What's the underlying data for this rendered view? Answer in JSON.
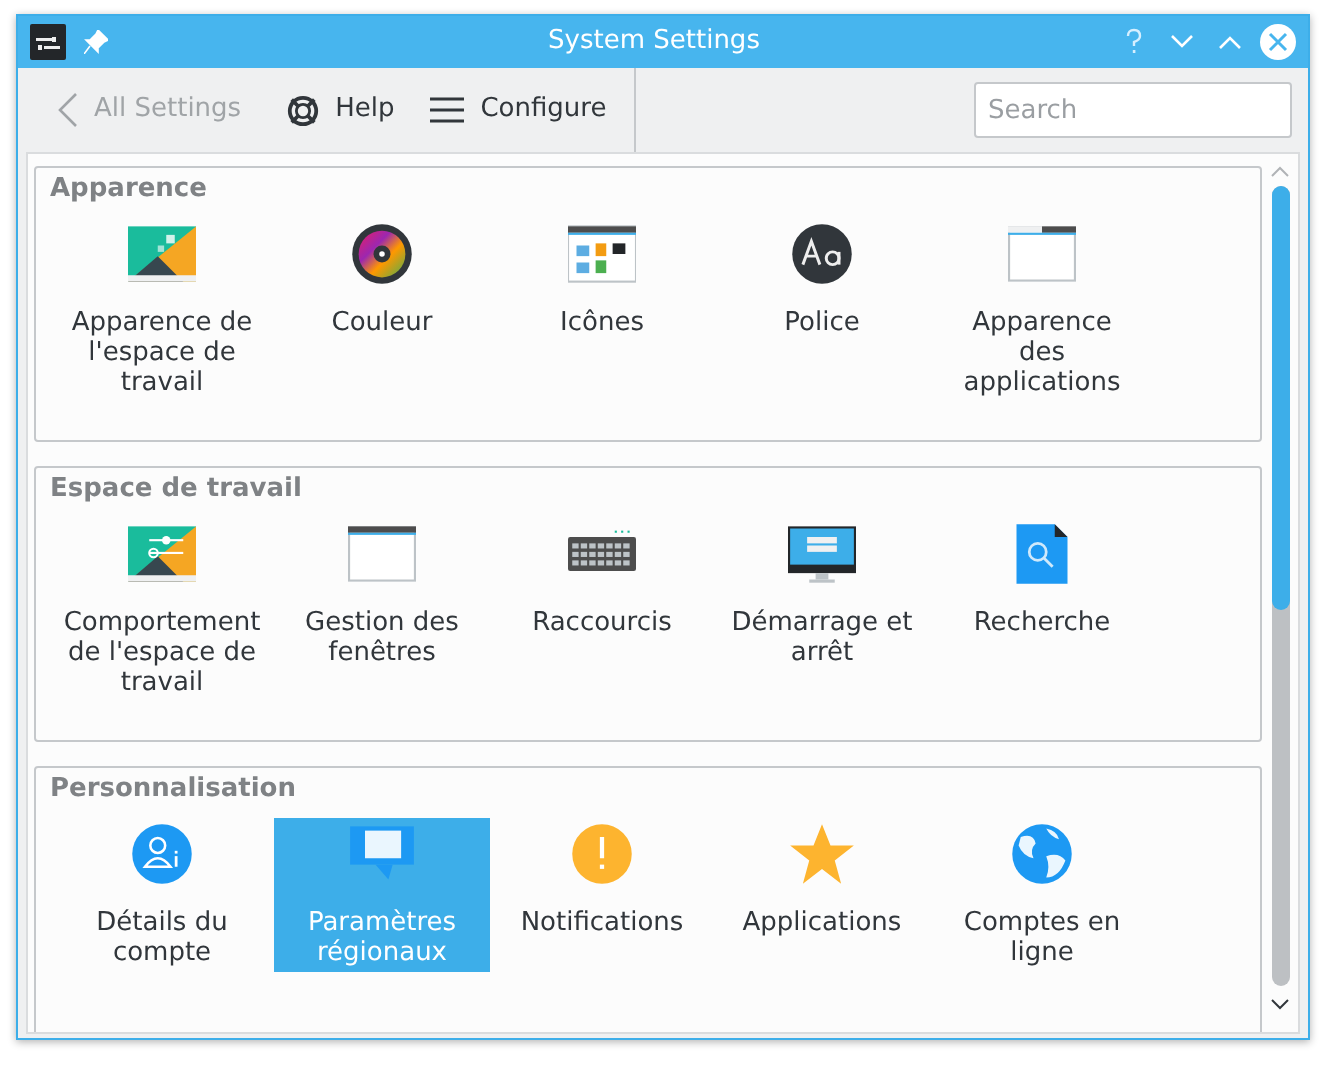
{
  "window": {
    "title": "System Settings"
  },
  "toolbar": {
    "back": {
      "label": "All Settings",
      "disabled": true
    },
    "help": "Help",
    "configure": "Configure",
    "search": {
      "placeholder": "Search"
    }
  },
  "sections": [
    {
      "title": "Apparence",
      "items": [
        {
          "label": "Apparence de l'espace de travail",
          "selected": false
        },
        {
          "label": "Couleur",
          "selected": false
        },
        {
          "label": "Icônes",
          "selected": false
        },
        {
          "label": "Police",
          "selected": false
        },
        {
          "label": "Apparence des applications",
          "selected": false
        }
      ]
    },
    {
      "title": "Espace de travail",
      "items": [
        {
          "label": "Comportement de l'espace de travail",
          "selected": false
        },
        {
          "label": "Gestion des fenêtres",
          "selected": false
        },
        {
          "label": "Raccourcis",
          "selected": false
        },
        {
          "label": "Démarrage et arrêt",
          "selected": false
        },
        {
          "label": "Recherche",
          "selected": false
        }
      ]
    },
    {
      "title": "Personnalisation",
      "items": [
        {
          "label": "Détails du compte",
          "selected": false
        },
        {
          "label": "Paramètres régionaux",
          "selected": true
        },
        {
          "label": "Notifications",
          "selected": false
        },
        {
          "label": "Applications",
          "selected": false
        },
        {
          "label": "Comptes en ligne",
          "selected": false
        }
      ]
    }
  ]
}
